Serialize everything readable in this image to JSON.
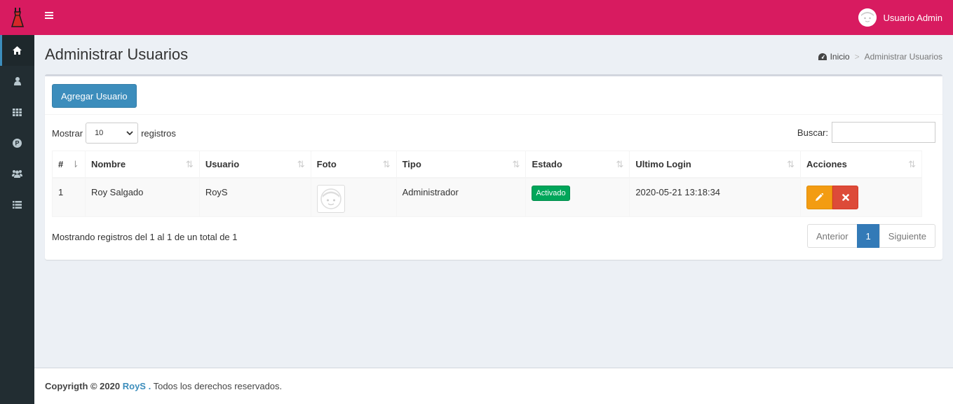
{
  "header": {
    "user_name": "Usuario Admin"
  },
  "sidebar": {
    "items": [
      {
        "icon": "home-icon"
      },
      {
        "icon": "user-icon"
      },
      {
        "icon": "grid-icon"
      },
      {
        "icon": "product-icon"
      },
      {
        "icon": "users-icon"
      },
      {
        "icon": "list-icon"
      }
    ]
  },
  "page": {
    "title": "Administrar Usuarios",
    "breadcrumb_home": "Inicio",
    "breadcrumb_current": "Administrar Usuarios"
  },
  "box": {
    "add_button": "Agregar Usuario",
    "length_prefix": "Mostrar",
    "length_value": "10",
    "length_suffix": "registros",
    "search_label": "Buscar:",
    "search_value": ""
  },
  "table": {
    "columns": [
      "#",
      "Nombre",
      "Usuario",
      "Foto",
      "Tipo",
      "Estado",
      "Ultimo Login",
      "Acciones"
    ],
    "rows": [
      {
        "num": "1",
        "nombre": "Roy Salgado",
        "usuario": "RoyS",
        "tipo": "Administrador",
        "estado": "Activado",
        "ultimo_login": "2020-05-21 13:18:34"
      }
    ]
  },
  "pagination": {
    "info": "Mostrando registros del 1 al 1 de un total de 1",
    "prev": "Anterior",
    "current": "1",
    "next": "Siguiente"
  },
  "footer": {
    "copy": "Copyrigth © 2020",
    "brand": "RoyS .",
    "rights": "Todos los derechos reservados."
  },
  "colors": {
    "topbar": "#d81b60",
    "sidebar": "#222d32",
    "primary": "#3c8dbc",
    "success": "#00a65a",
    "warning": "#f39c12",
    "danger": "#dd4b39"
  }
}
